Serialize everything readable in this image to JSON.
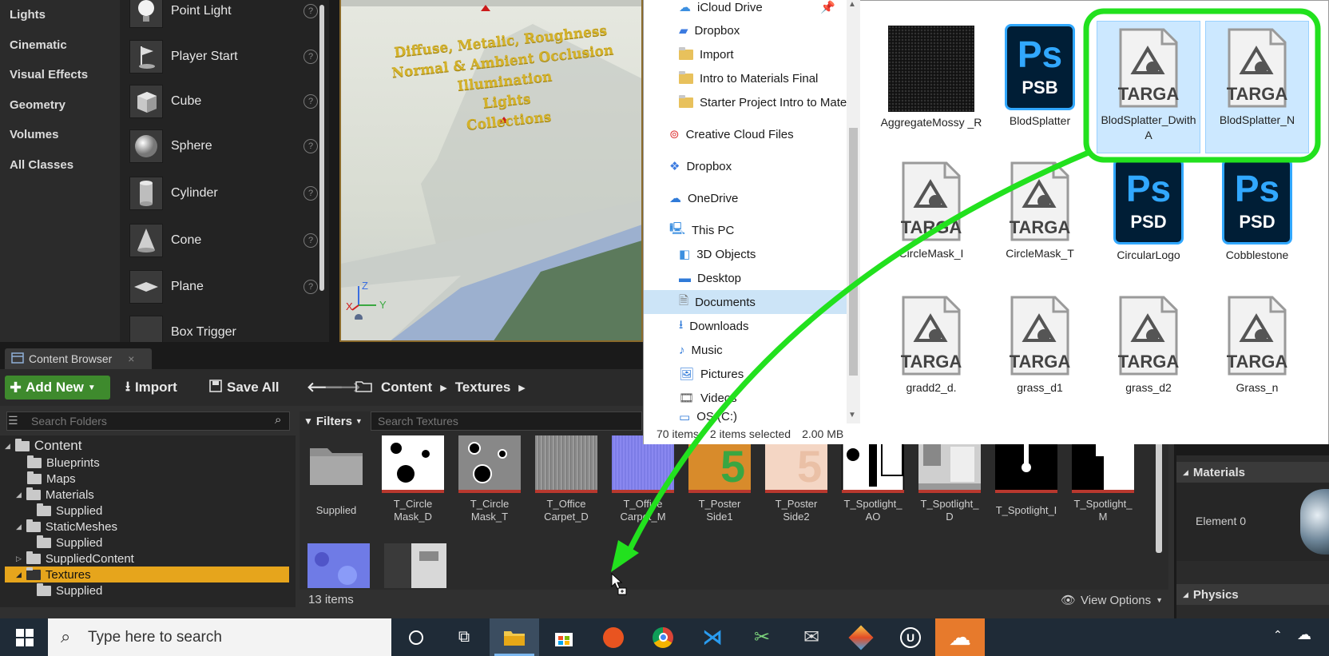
{
  "place_actors": {
    "categories": [
      "Lights",
      "Cinematic",
      "Visual Effects",
      "Geometry",
      "Volumes",
      "All Classes"
    ],
    "items": [
      "Point Light",
      "Player Start",
      "Cube",
      "Sphere",
      "Cylinder",
      "Cone",
      "Plane",
      "Box Trigger"
    ]
  },
  "viewport": {
    "lines": [
      "Diffuse, Metalic, Roughness",
      "Normal & Ambient Occlusion",
      "Illumination",
      "Lights",
      "Collections"
    ],
    "axis_z": "Z",
    "axis_y": "Y",
    "axis_x": "X"
  },
  "content_browser": {
    "tab_label": "Content Browser",
    "add_new": "Add New",
    "import": "Import",
    "save_all": "Save All",
    "breadcrumb": [
      "Content",
      "Textures"
    ],
    "search_folders_placeholder": "Search Folders",
    "filters": "Filters",
    "search_textures_placeholder": "Search Textures",
    "tree": [
      "Content",
      "Blueprints",
      "Maps",
      "Materials",
      "Supplied",
      "StaticMeshes",
      "Supplied",
      "SuppliedContent",
      "Textures",
      "Supplied"
    ],
    "assets": [
      "Supplied",
      "T_Circle Mask_D",
      "T_Circle Mask_T",
      "T_Office Carpet_D",
      "T_Office Carpet_M",
      "T_Poster Side1",
      "T_Poster Side2",
      "T_Spotlight_ AO",
      "T_Spotlight_ D",
      "T_Spotlight_I",
      "T_Spotlight_ M"
    ],
    "items_count": "13 items",
    "view_options": "View Options"
  },
  "details": {
    "materials_header": "Materials",
    "element_label": "Element 0",
    "physics_header": "Physics"
  },
  "explorer": {
    "nav": [
      "iCloud Drive",
      "Dropbox",
      "Import",
      "Intro to Materials Final",
      "Starter Project Intro to Mate",
      "Creative Cloud Files",
      "Dropbox",
      "OneDrive",
      "This PC",
      "3D Objects",
      "Desktop",
      "Documents",
      "Downloads",
      "Music",
      "Pictures",
      "Videos",
      "OS (C:)"
    ],
    "files": [
      "AggregateMossy _R",
      "BlodSplatter",
      "BlodSplatter_Dwith A",
      "BlodSplatter_N",
      "CircleMask_I",
      "CircleMask_T",
      "CircularLogo",
      "Cobblestone",
      "gradd2_d.",
      "grass_d1",
      "grass_d2",
      "Grass_n"
    ],
    "targa_label": "TARGA",
    "psb_label": "PSB",
    "psd_label": "PSD",
    "ps_label": "Ps",
    "status_items": "70 items",
    "status_selected": "2 items selected",
    "status_size": "2.00 MB"
  },
  "taskbar": {
    "search_placeholder": "Type here to search"
  },
  "colors": {
    "annotation_green": "#22e11e",
    "ue_add_green": "#3e8a2d",
    "textures_highlight": "#e6a51c"
  }
}
